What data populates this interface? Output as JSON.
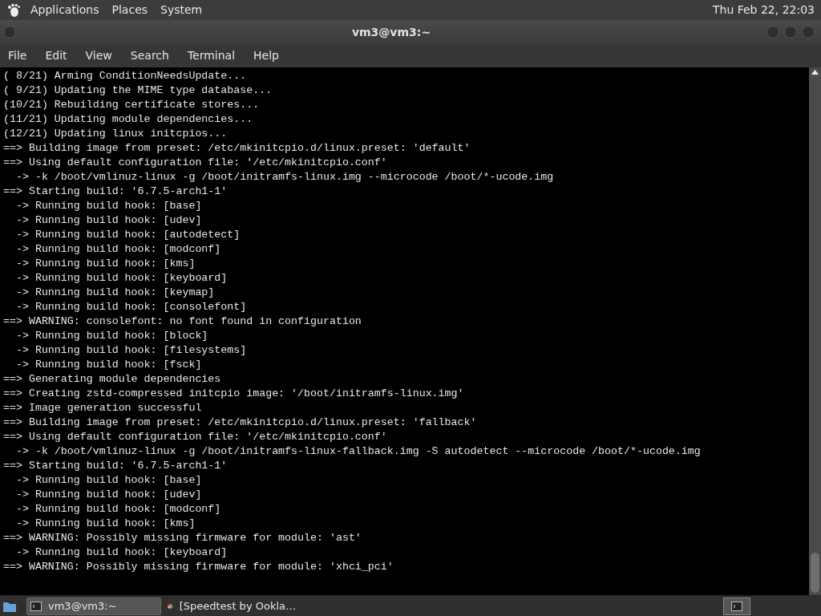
{
  "top_panel": {
    "menus": [
      "Applications",
      "Places",
      "System"
    ],
    "clock": "Thu Feb 22, 22:03"
  },
  "window": {
    "title": "vm3@vm3:~"
  },
  "menu_bar": [
    "File",
    "Edit",
    "View",
    "Search",
    "Terminal",
    "Help"
  ],
  "terminal": {
    "lines": [
      "( 8/21) Arming ConditionNeedsUpdate...",
      "( 9/21) Updating the MIME type database...",
      "(10/21) Rebuilding certificate stores...",
      "(11/21) Updating module dependencies...",
      "(12/21) Updating linux initcpios...",
      "==> Building image from preset: /etc/mkinitcpio.d/linux.preset: 'default'",
      "==> Using default configuration file: '/etc/mkinitcpio.conf'",
      "  -> -k /boot/vmlinuz-linux -g /boot/initramfs-linux.img --microcode /boot/*-ucode.img",
      "==> Starting build: '6.7.5-arch1-1'",
      "  -> Running build hook: [base]",
      "  -> Running build hook: [udev]",
      "  -> Running build hook: [autodetect]",
      "  -> Running build hook: [modconf]",
      "  -> Running build hook: [kms]",
      "  -> Running build hook: [keyboard]",
      "  -> Running build hook: [keymap]",
      "  -> Running build hook: [consolefont]",
      "==> WARNING: consolefont: no font found in configuration",
      "  -> Running build hook: [block]",
      "  -> Running build hook: [filesystems]",
      "  -> Running build hook: [fsck]",
      "==> Generating module dependencies",
      "==> Creating zstd-compressed initcpio image: '/boot/initramfs-linux.img'",
      "==> Image generation successful",
      "==> Building image from preset: /etc/mkinitcpio.d/linux.preset: 'fallback'",
      "==> Using default configuration file: '/etc/mkinitcpio.conf'",
      "  -> -k /boot/vmlinuz-linux -g /boot/initramfs-linux-fallback.img -S autodetect --microcode /boot/*-ucode.img",
      "==> Starting build: '6.7.5-arch1-1'",
      "  -> Running build hook: [base]",
      "  -> Running build hook: [udev]",
      "  -> Running build hook: [modconf]",
      "  -> Running build hook: [kms]",
      "==> WARNING: Possibly missing firmware for module: 'ast'",
      "  -> Running build hook: [keyboard]",
      "==> WARNING: Possibly missing firmware for module: 'xhci_pci'"
    ]
  },
  "taskbar": {
    "items": [
      {
        "kind": "terminal",
        "label": "vm3@vm3:~",
        "selected": true
      },
      {
        "kind": "browser",
        "label": "[Speedtest by Ookla…",
        "selected": false
      }
    ]
  }
}
